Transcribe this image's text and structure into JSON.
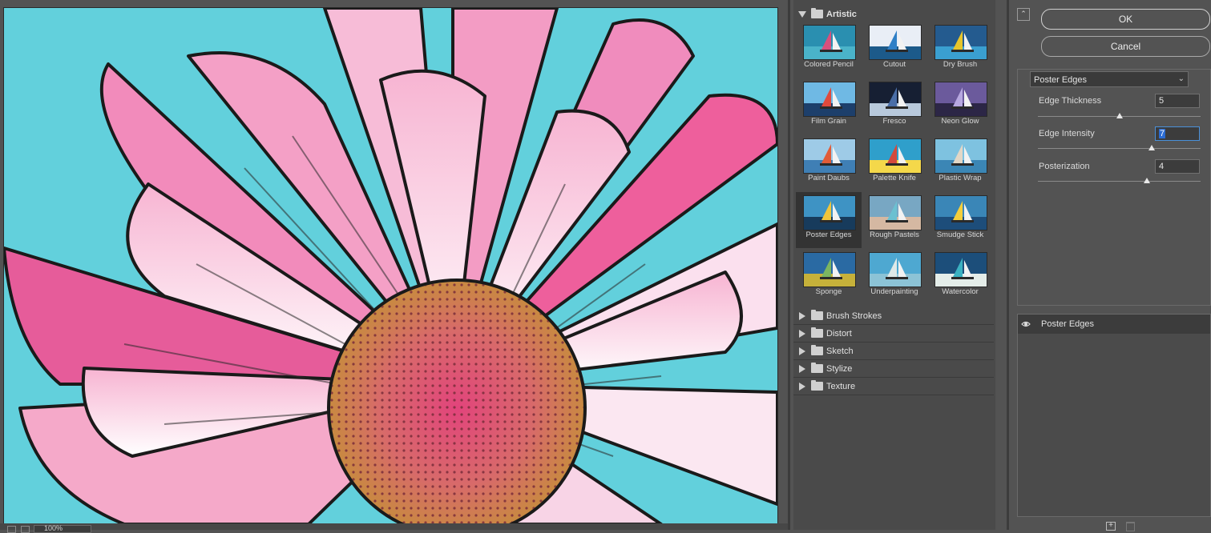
{
  "dialog": {
    "ok_label": "OK",
    "cancel_label": "Cancel"
  },
  "preview": {
    "zoom": "100%",
    "image": "Pink daisy with Poster Edges filter applied"
  },
  "gallery": {
    "open_folder": "Artistic",
    "filters": [
      {
        "label": "Colored Pencil",
        "selected": false
      },
      {
        "label": "Cutout",
        "selected": false
      },
      {
        "label": "Dry Brush",
        "selected": false
      },
      {
        "label": "Film Grain",
        "selected": false
      },
      {
        "label": "Fresco",
        "selected": false
      },
      {
        "label": "Neon Glow",
        "selected": false
      },
      {
        "label": "Paint Daubs",
        "selected": false
      },
      {
        "label": "Palette Knife",
        "selected": false
      },
      {
        "label": "Plastic Wrap",
        "selected": false
      },
      {
        "label": "Poster Edges",
        "selected": true
      },
      {
        "label": "Rough Pastels",
        "selected": false
      },
      {
        "label": "Smudge Stick",
        "selected": false
      },
      {
        "label": "Sponge",
        "selected": false
      },
      {
        "label": "Underpainting",
        "selected": false
      },
      {
        "label": "Watercolor",
        "selected": false
      }
    ],
    "folders": [
      "Brush Strokes",
      "Distort",
      "Sketch",
      "Stylize",
      "Texture"
    ]
  },
  "settings": {
    "filter_select": "Poster Edges",
    "params": [
      {
        "label": "Edge Thickness",
        "value": "5",
        "level": 0.5
      },
      {
        "label": "Edge Intensity",
        "value": "7",
        "level": 0.7
      },
      {
        "label": "Posterization",
        "value": "4",
        "level": 0.67
      }
    ]
  },
  "layers": {
    "items": [
      {
        "label": "Poster Edges",
        "visible": true
      }
    ]
  },
  "colors": {
    "panel_bg": "#535353",
    "gallery_bg": "#4a4a4a",
    "selected_bg": "#333333",
    "focus_blue": "#4a90d9",
    "petal_pink": "#f06aa6",
    "sky_cyan": "#5fd3df"
  }
}
